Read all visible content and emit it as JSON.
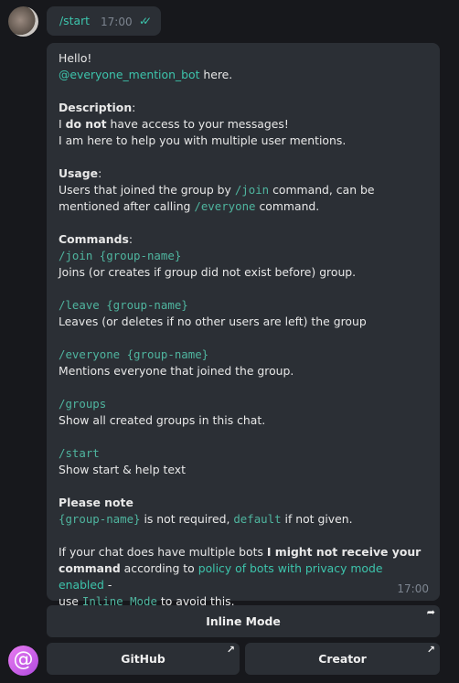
{
  "sent": {
    "command": "/start",
    "time": "17:00",
    "status_icon": "double-check-icon"
  },
  "message": {
    "time": "17:00",
    "paragraphs": [
      [
        {
          "t": "text",
          "v": "Hello!"
        }
      ],
      [
        {
          "t": "link",
          "v": "@everyone_mention_bot"
        },
        {
          "t": "text",
          "v": " here."
        }
      ],
      [],
      [
        {
          "t": "bold",
          "v": "Description"
        },
        {
          "t": "text",
          "v": ":"
        }
      ],
      [
        {
          "t": "text",
          "v": "I "
        },
        {
          "t": "bold",
          "v": "do not"
        },
        {
          "t": "text",
          "v": " have access to your messages!"
        }
      ],
      [
        {
          "t": "text",
          "v": "I am here to help you with multiple user mentions."
        }
      ],
      [],
      [
        {
          "t": "bold",
          "v": "Usage"
        },
        {
          "t": "text",
          "v": ":"
        }
      ],
      [
        {
          "t": "text",
          "v": "Users that joined the group by "
        },
        {
          "t": "code",
          "v": "/join"
        },
        {
          "t": "text",
          "v": " command, can be"
        }
      ],
      [
        {
          "t": "text",
          "v": "mentioned after calling "
        },
        {
          "t": "code",
          "v": "/everyone"
        },
        {
          "t": "text",
          "v": " command."
        }
      ],
      [],
      [
        {
          "t": "bold",
          "v": "Commands"
        },
        {
          "t": "text",
          "v": ":"
        }
      ],
      [
        {
          "t": "code",
          "v": "/join {group-name}"
        }
      ],
      [
        {
          "t": "text",
          "v": "Joins (or creates if group did not exist before) group."
        }
      ],
      [],
      [
        {
          "t": "code",
          "v": "/leave {group-name}"
        }
      ],
      [
        {
          "t": "text",
          "v": "Leaves (or deletes if no other users are left) the group"
        }
      ],
      [],
      [
        {
          "t": "code",
          "v": "/everyone {group-name}"
        }
      ],
      [
        {
          "t": "text",
          "v": "Mentions everyone that joined the group."
        }
      ],
      [],
      [
        {
          "t": "code",
          "v": "/groups"
        }
      ],
      [
        {
          "t": "text",
          "v": "Show all created groups in this chat."
        }
      ],
      [],
      [
        {
          "t": "code",
          "v": "/start"
        }
      ],
      [
        {
          "t": "text",
          "v": "Show start & help text"
        }
      ],
      [],
      [
        {
          "t": "bold",
          "v": "Please note"
        }
      ],
      [
        {
          "t": "code",
          "v": "{group-name}"
        },
        {
          "t": "text",
          "v": " is not required, "
        },
        {
          "t": "code",
          "v": "default"
        },
        {
          "t": "text",
          "v": " if not given."
        }
      ],
      [],
      [
        {
          "t": "text",
          "v": "If your chat does have multiple bots "
        },
        {
          "t": "bold",
          "v": "I might not receive your"
        }
      ],
      [
        {
          "t": "bold",
          "v": "command"
        },
        {
          "t": "text",
          "v": " according to "
        },
        {
          "t": "link",
          "v": "policy of bots with privacy mode enabled"
        },
        {
          "t": "text",
          "v": " -"
        }
      ],
      [
        {
          "t": "text",
          "v": "use "
        },
        {
          "t": "code",
          "v": "Inline Mode"
        },
        {
          "t": "text",
          "v": " to avoid this."
        }
      ]
    ]
  },
  "buttons": {
    "inline": "Inline Mode",
    "github": "GitHub",
    "creator": "Creator"
  },
  "icons": {
    "bot_avatar": "@",
    "share": "share-icon",
    "external": "arrow-up-right-icon"
  }
}
